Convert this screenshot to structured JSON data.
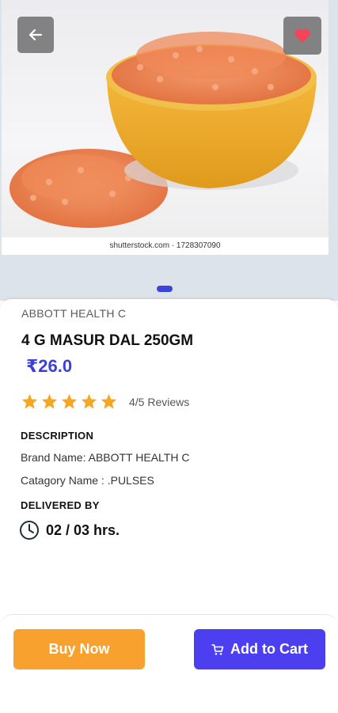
{
  "image": {
    "watermark": "shutterstock.com · 1728307090",
    "carousel_dots": 1
  },
  "header": {
    "back_icon": "arrow-left-icon",
    "favorite_icon": "heart-icon"
  },
  "product": {
    "brand": "ABBOTT HEALTH C",
    "name": "4 G MASUR DAL 250GM",
    "price": "₹26.0",
    "rating": 5,
    "rating_max": 5,
    "reviews_text": "4/5 Reviews",
    "description_heading": "DESCRIPTION",
    "brand_line": "Brand Name: ABBOTT HEALTH C",
    "category_line": "Catagory Name : .PULSES",
    "delivered_heading": "DELIVERED BY",
    "delivery_time": "02 / 03 hrs."
  },
  "actions": {
    "buy_label": "Buy Now",
    "cart_label": "Add to Cart"
  },
  "colors": {
    "accent": "#3b3fd8",
    "star": "#f5a623",
    "buy": "#f9a12e",
    "cart": "#4b3ff0",
    "favorite": "#f2455a"
  }
}
